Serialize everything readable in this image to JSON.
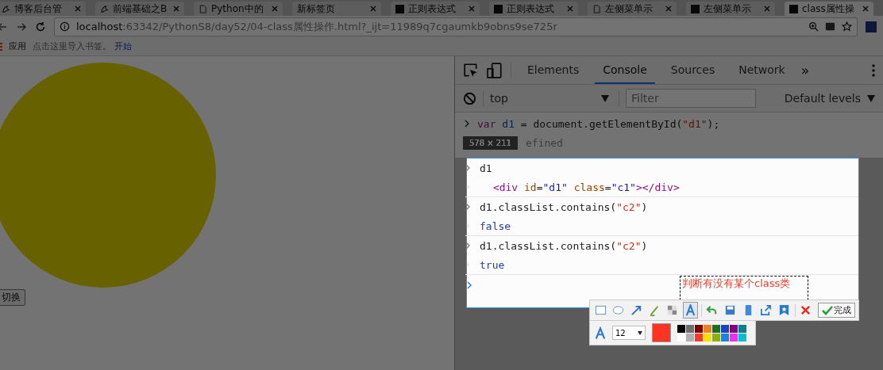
{
  "browser": {
    "tabs": [
      {
        "title": "博客后台管",
        "kind": "bird",
        "selected": false
      },
      {
        "title": "前端基础之B",
        "kind": "bird",
        "selected": false
      },
      {
        "title": "Python中的",
        "kind": "page",
        "selected": false
      },
      {
        "title": "新标签页",
        "kind": "blank",
        "selected": false
      },
      {
        "title": "正则表达式",
        "kind": "pc",
        "selected": false
      },
      {
        "title": "正则表达式",
        "kind": "pc",
        "selected": false
      },
      {
        "title": "左侧菜单示",
        "kind": "page",
        "selected": false
      },
      {
        "title": "左侧菜单示",
        "kind": "pc",
        "selected": false
      },
      {
        "title": "class属性操",
        "kind": "pc",
        "selected": true
      }
    ],
    "url_host": "localhost",
    "url_rest": ":63342/PythonS8/day52/04-class属性操作.html?_ijt=11989q7cgaumkb9obns9se725r",
    "bookmarks": {
      "apps": "应用",
      "hint": "点击这里导入书签。",
      "link": "开始"
    }
  },
  "page": {
    "button": "切换"
  },
  "devtools": {
    "tabs": [
      {
        "label": "Elements",
        "selected": false
      },
      {
        "label": "Console",
        "selected": true
      },
      {
        "label": "Sources",
        "selected": false
      },
      {
        "label": "Network",
        "selected": false
      }
    ],
    "more": "»",
    "context": "top",
    "filter_placeholder": "Filter",
    "levels": "Default levels",
    "log_before": [
      {
        "kind": "input",
        "tokens": [
          {
            "kind": "keyword",
            "text": "var"
          },
          {
            "kind": "variable",
            "text": " d1"
          },
          {
            "kind": "plain",
            "text": " = document.getElementById("
          },
          {
            "kind": "string",
            "text": "\"d1\""
          },
          {
            "kind": "plain",
            "text": ");"
          }
        ]
      },
      {
        "kind": "output",
        "tokens": [
          {
            "kind": "muted",
            "text": "efined"
          }
        ]
      }
    ],
    "log": [
      {
        "kind": "input",
        "tokens": [
          {
            "kind": "plain",
            "text": "d1"
          }
        ]
      },
      {
        "kind": "output",
        "tokens": [
          {
            "kind": "tag",
            "text": "<div"
          },
          {
            "kind": "attr",
            "text": " id"
          },
          {
            "kind": "plain",
            "text": "="
          },
          {
            "kind": "value",
            "text": "\"d1\""
          },
          {
            "kind": "attr",
            "text": " class"
          },
          {
            "kind": "plain",
            "text": "="
          },
          {
            "kind": "value",
            "text": "\"c1\""
          },
          {
            "kind": "tag",
            "text": "></div>"
          }
        ]
      },
      {
        "kind": "input",
        "tokens": [
          {
            "kind": "plain",
            "text": "d1.classList.contains("
          },
          {
            "kind": "string",
            "text": "\"c2\""
          },
          {
            "kind": "plain",
            "text": ")"
          }
        ]
      },
      {
        "kind": "output",
        "tokens": [
          {
            "kind": "boolean",
            "text": "false"
          }
        ]
      },
      {
        "kind": "input",
        "tokens": [
          {
            "kind": "plain",
            "text": "d1.classList.contains("
          },
          {
            "kind": "string",
            "text": "\"c2\""
          },
          {
            "kind": "plain",
            "text": ")"
          }
        ]
      },
      {
        "kind": "output",
        "tokens": [
          {
            "kind": "boolean",
            "text": "true"
          }
        ]
      }
    ]
  },
  "capture": {
    "size_label": "578 × 211",
    "annotation": "判断有没有某个class类",
    "tools": [
      {
        "kind": "rect",
        "selected": false
      },
      {
        "kind": "ellipse",
        "selected": false
      },
      {
        "kind": "arrow",
        "selected": false
      },
      {
        "kind": "brush",
        "selected": false
      },
      {
        "kind": "mosaic",
        "selected": false
      },
      {
        "kind": "text",
        "selected": true
      },
      {
        "kind": "undo",
        "selected": false
      },
      {
        "kind": "save",
        "selected": false
      },
      {
        "kind": "phone",
        "selected": false
      },
      {
        "kind": "share",
        "selected": false
      },
      {
        "kind": "pin",
        "selected": false
      },
      {
        "kind": "cancel",
        "selected": false
      }
    ],
    "done": "完成",
    "font_size": "12",
    "current": {
      "color": "#ff3322"
    },
    "palette": [
      {
        "color": "#000000"
      },
      {
        "color": "#6e6e6e"
      },
      {
        "color": "#7a0000"
      },
      {
        "color": "#f08020"
      },
      {
        "color": "#1e6e1e"
      },
      {
        "color": "#2040c0"
      },
      {
        "color": "#800080"
      },
      {
        "color": "#00808a"
      },
      {
        "color": "#ffffff"
      },
      {
        "color": "#b0b0b0"
      },
      {
        "color": "#f03c28"
      },
      {
        "color": "#f8e000"
      },
      {
        "color": "#90b000"
      },
      {
        "color": "#2080e0"
      },
      {
        "color": "#f030f0"
      },
      {
        "color": "#00c0d0"
      }
    ]
  }
}
